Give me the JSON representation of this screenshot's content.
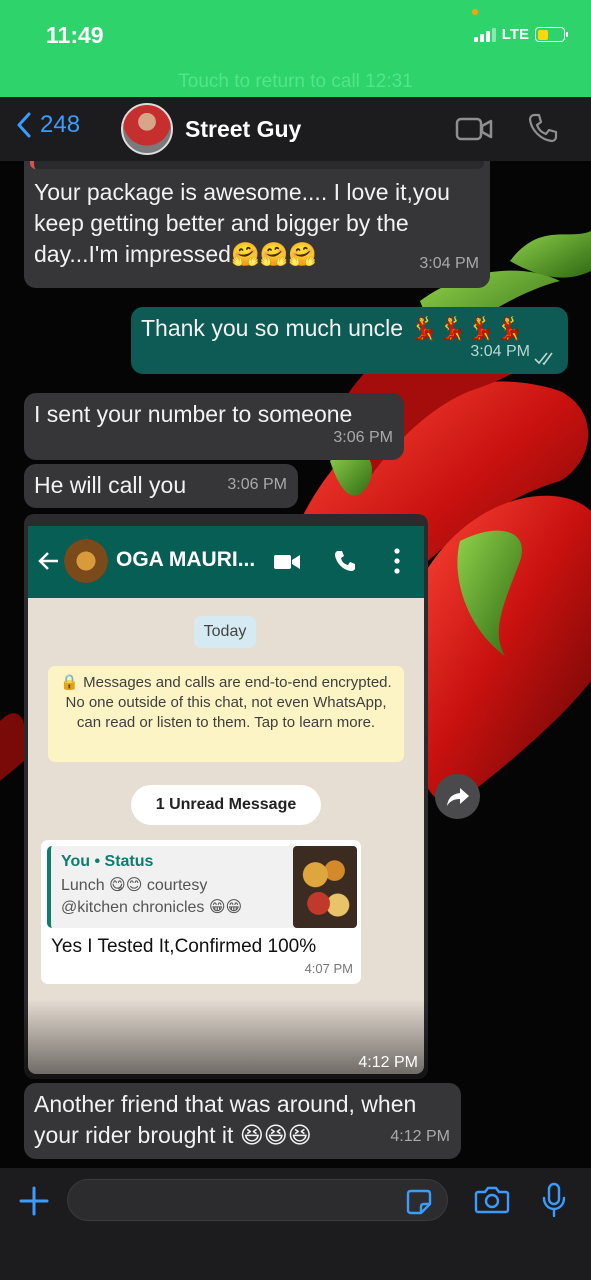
{
  "status_bar": {
    "time": "11:49",
    "network": "LTE",
    "call_banner": "Touch to return to call 12:31"
  },
  "header": {
    "back_count": "248",
    "contact_name": "Street Guy"
  },
  "messages": [
    {
      "text": "Your package is awesome.... I love it,you keep getting better and bigger by the day...I'm impressed🤗🤗🤗",
      "time": "3:04 PM"
    },
    {
      "text": "Thank you so much uncle 💃💃💃💃",
      "time": "3:04 PM"
    },
    {
      "text": "I sent your number to someone",
      "time": "3:06 PM"
    },
    {
      "text": "He will call you",
      "time": "3:06 PM"
    },
    {
      "text": "Another friend that was around, when your rider brought it 😆😆😆",
      "time": "4:12 PM"
    }
  ],
  "forwarded_image": {
    "time": "4:12 PM",
    "title": "OGA MAURI...",
    "date_chip": "Today",
    "encryption_notice": "🔒 Messages and calls are end-to-end encrypted. No one outside of this chat, not even WhatsApp, can read or listen to them. Tap to learn more.",
    "unread": "1 Unread Message",
    "quote_author": "You • Status",
    "quote_text": "Lunch 😋😊 courtesy @kitchen chronicles 😁😁",
    "reply_text": "Yes I Tested It,Confirmed 100%",
    "reply_time": "4:07 PM"
  },
  "colors": {
    "status_green": "#2fd36b",
    "ios_blue": "#3b9cff",
    "outgoing_bubble": "#0d5b54",
    "incoming_bubble": "#363638",
    "whatsapp_header": "#075e54"
  },
  "icons": [
    "chevron-left-icon",
    "video-icon",
    "phone-icon",
    "share-icon",
    "plus-icon",
    "sticker-icon",
    "camera-icon",
    "mic-icon"
  ]
}
